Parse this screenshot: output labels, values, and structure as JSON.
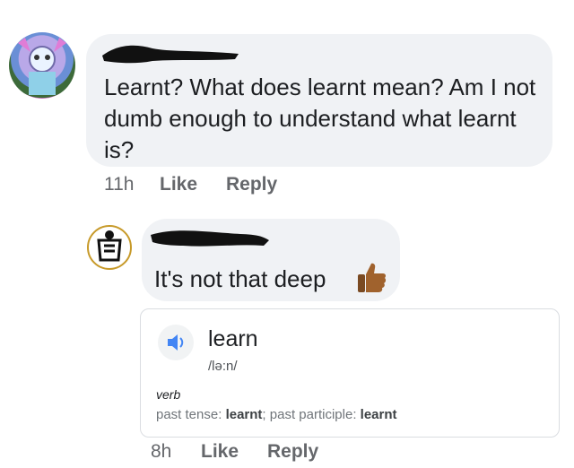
{
  "comment1": {
    "text": "Learnt? What does learnt mean? Am I not dumb enough to understand what learnt is?",
    "time": "11h",
    "like_label": "Like",
    "reply_label": "Reply"
  },
  "comment2": {
    "text": "It's not that deep",
    "reaction_icon": "thumbs-up-emoji",
    "time": "8h",
    "like_label": "Like",
    "reply_label": "Reply"
  },
  "definition": {
    "word": "learn",
    "phonetic": "/lə:n/",
    "part_of_speech": "verb",
    "past_tense_label": "past tense:",
    "past_tense": "learnt",
    "separator": ";",
    "past_participle_label": "past participle:",
    "past_participle": "learnt",
    "audio_icon": "speaker-icon"
  },
  "colors": {
    "bubble": "#f0f2f5",
    "meta_text": "#65676b",
    "speaker_blue": "#4285f4"
  }
}
